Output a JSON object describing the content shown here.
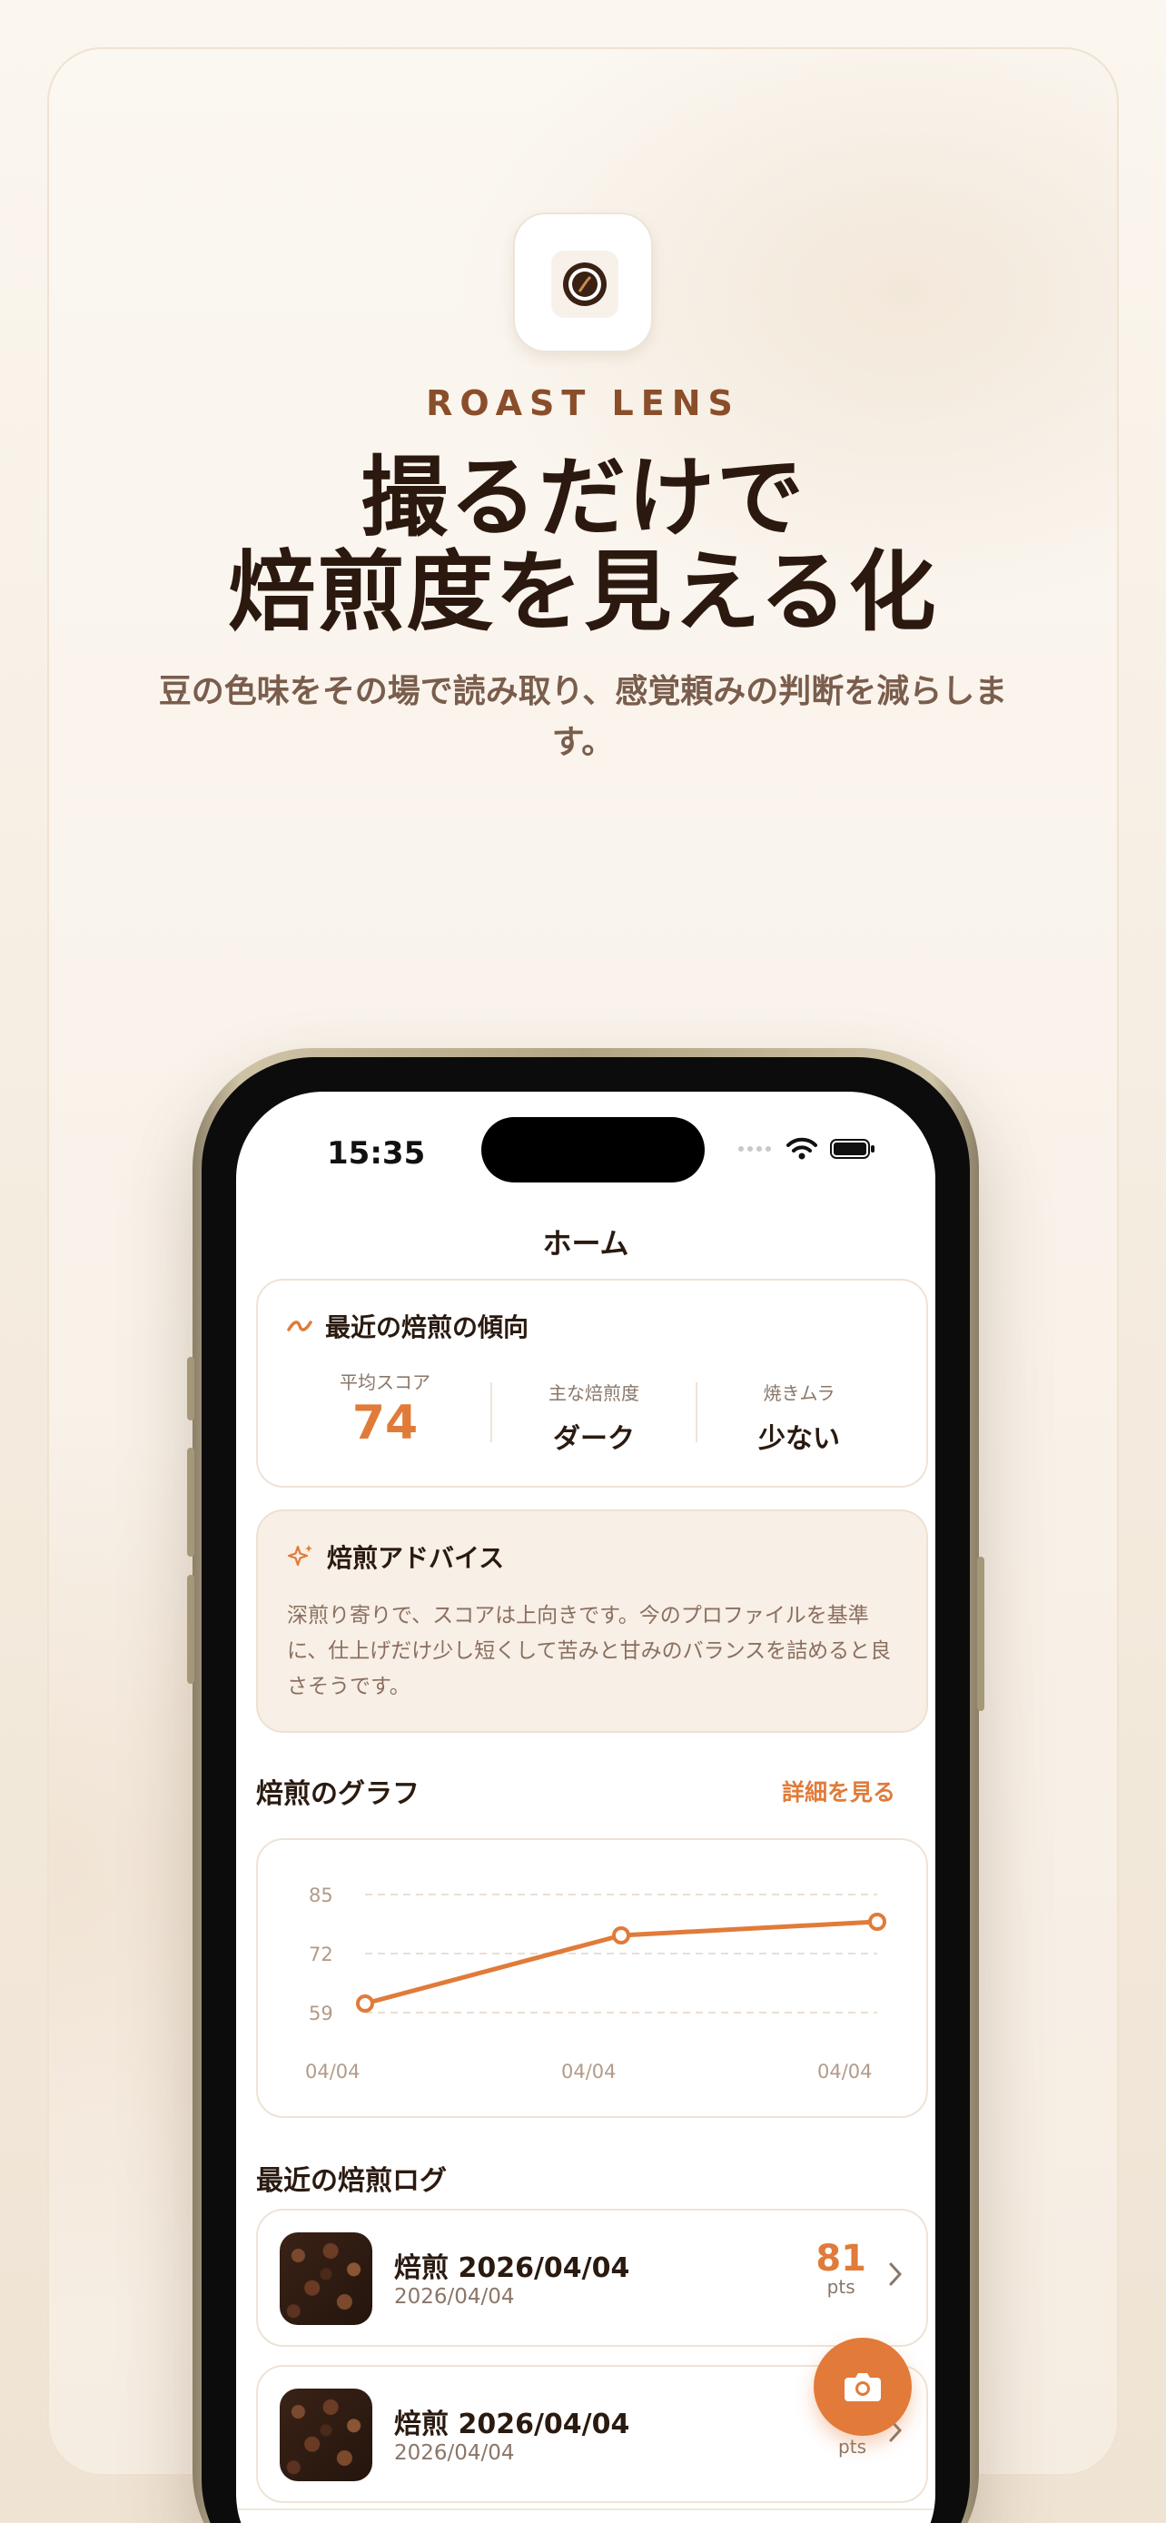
{
  "hero": {
    "brand": "ROAST LENS",
    "headline_line1": "撮るだけで",
    "headline_line2": "焙煎度を見える化",
    "subline": "豆の色味をその場で読み取り、感覚頼みの判断を減らします。"
  },
  "status_bar": {
    "time": "15:35"
  },
  "nav": {
    "title": "ホーム"
  },
  "trend": {
    "title": "最近の焙煎の傾向",
    "stats": [
      {
        "label": "平均スコア",
        "value": "74"
      },
      {
        "label": "主な焙煎度",
        "value": "ダーク"
      },
      {
        "label": "焼きムラ",
        "value": "少ない"
      }
    ]
  },
  "advice": {
    "title": "焙煎アドバイス",
    "body": "深煎り寄りで、スコアは上向きです。今のプロファイルを基準に、仕上げだけ少し短くして苦みと甘みのバランスを詰めると良さそうです。"
  },
  "graph_section": {
    "title": "焙煎のグラフ",
    "link": "詳細を見る"
  },
  "chart_data": {
    "type": "line",
    "categories": [
      "04/04",
      "04/04",
      "04/04"
    ],
    "y_ticks": [
      "85",
      "72",
      "59"
    ],
    "ylim": [
      59,
      85
    ],
    "grid": true,
    "series": [
      {
        "values": [
          61,
          76,
          79
        ]
      }
    ]
  },
  "logs_section": {
    "title": "最近の焙煎ログ"
  },
  "logs": [
    {
      "title": "焙煎 2026/04/04",
      "date": "2026/04/04",
      "score": "81",
      "unit": "pts"
    },
    {
      "title": "焙煎 2026/04/04",
      "date": "2026/04/04",
      "score": "",
      "unit": "pts"
    }
  ],
  "colors": {
    "accent": "#e07b39",
    "brand": "#8a4e2b",
    "text": "#2a1a10"
  },
  "icons": [
    "trend-icon",
    "sparkle-icon",
    "chevron-right-icon",
    "camera-icon",
    "home-tab-icon",
    "book-tab-icon",
    "settings-tab-icon",
    "wifi-icon",
    "battery-icon",
    "app-logo-icon"
  ]
}
